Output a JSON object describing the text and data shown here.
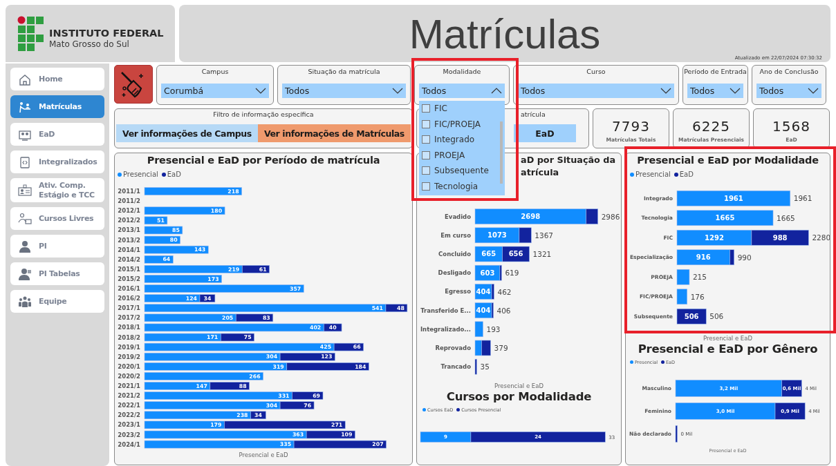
{
  "logo": {
    "name": "INSTITUTO FEDERAL",
    "subtitle": "Mato Grosso do Sul"
  },
  "header": {
    "title": "Matrículas",
    "updated": "Atualizado em 22/07/2024 07:30:32"
  },
  "sidebar": {
    "items": [
      {
        "label": "Home",
        "selected": false
      },
      {
        "label": "Matrículas",
        "selected": true
      },
      {
        "label": "EaD",
        "selected": false
      },
      {
        "label": "Integralizados",
        "selected": false
      },
      {
        "label": "Ativ. Comp.\nEstágio e TCC",
        "selected": false
      },
      {
        "label": "Cursos Livres",
        "selected": false
      },
      {
        "label": "PI",
        "selected": false
      },
      {
        "label": "PI Tabelas",
        "selected": false
      },
      {
        "label": "Equipe",
        "selected": false
      }
    ]
  },
  "filters": [
    {
      "label": "Campus",
      "value": "Corumbá",
      "expanded": false,
      "highlighted": false
    },
    {
      "label": "Situação da matrícula",
      "value": "Todos",
      "expanded": false,
      "highlighted": false
    },
    {
      "label": "Modalidade",
      "value": "Todos",
      "expanded": true,
      "highlighted": true,
      "options": [
        {
          "label": "FIC",
          "checked": false
        },
        {
          "label": "FIC/PROEJA",
          "checked": false
        },
        {
          "label": "Integrado",
          "checked": false
        },
        {
          "label": "PROEJA",
          "checked": false
        },
        {
          "label": "Subsequente",
          "checked": false
        },
        {
          "label": "Tecnologia",
          "checked": false
        }
      ]
    },
    {
      "label": "Curso",
      "value": "Todos",
      "expanded": false,
      "highlighted": false
    },
    {
      "label": "Período de Entrada",
      "value": "Todos",
      "expanded": false,
      "highlighted": false
    },
    {
      "label": "Ano de Conclusão",
      "value": "Todos",
      "expanded": false,
      "highlighted": false
    }
  ],
  "info_filter": {
    "label": "Filtro de informação específica",
    "buttons": [
      {
        "label": "Ver informações de Campus",
        "selected": false
      },
      {
        "label": "Ver informações de Matrículas",
        "selected": true
      }
    ]
  },
  "type_filter": {
    "label": "atrícula",
    "button": "EaD"
  },
  "kpis": [
    {
      "value": "7793",
      "label": "Matrículas Totais"
    },
    {
      "value": "6225",
      "label": "Matrículas Presenciais"
    },
    {
      "value": "1568",
      "label": "EaD"
    }
  ],
  "charts": [
    {
      "kind": "period",
      "highlighted": false,
      "chart_data": {
        "type": "bar",
        "orientation": "horizontal",
        "stacked": true,
        "data_labels": "value_labels",
        "title": "Presencial e EaD por Período de matrícula",
        "xlabel": "Presencial e EaD",
        "categories": [
          "2011/1",
          "2011/2",
          "2012/1",
          "2012/2",
          "2013/1",
          "2013/2",
          "2014/1",
          "2014/2",
          "2015/1",
          "2015/2",
          "2016/1",
          "2016/2",
          "2017/1",
          "2017/2",
          "2018/1",
          "2018/2",
          "2019/1",
          "2019/2",
          "2020/1",
          "2020/2",
          "2021/1",
          "2021/2",
          "2022/1",
          "2022/2",
          "2023/1",
          "2023/2",
          "2024/1"
        ],
        "series": [
          {
            "name": "Presencial",
            "color": "#118dff",
            "values": [
              218,
              null,
              180,
              51,
              85,
              80,
              143,
              64,
              219,
              173,
              357,
              124,
              541,
              205,
              402,
              171,
              425,
              304,
              319,
              266,
              147,
              331,
              304,
              238,
              179,
              363,
              335
            ],
            "value_labels": [
              "218",
              null,
              "180",
              "51",
              "85",
              "80",
              "143",
              "64",
              "219",
              "173",
              "357",
              "124",
              "541",
              "205",
              "402",
              "171",
              "425",
              "304",
              "319",
              "266",
              "147",
              "331",
              "304",
              "238",
              "179",
              "363",
              "335"
            ]
          },
          {
            "name": "EaD",
            "color": "#12239e",
            "values": [
              null,
              null,
              null,
              null,
              null,
              null,
              null,
              null,
              61,
              null,
              null,
              34,
              48,
              83,
              40,
              75,
              66,
              123,
              184,
              null,
              88,
              69,
              76,
              34,
              271,
              109,
              207
            ],
            "value_labels": [
              null,
              null,
              null,
              null,
              null,
              null,
              null,
              null,
              "61",
              null,
              null,
              "34",
              "48",
              "83",
              "40",
              "75",
              "66",
              "123",
              "184",
              null,
              "88",
              "69",
              "76",
              "34",
              "271",
              "109",
              "207"
            ]
          }
        ]
      }
    },
    {
      "kind": "situacao",
      "highlighted": false,
      "title_lines": [
        "aD por Situação da",
        "atrícula"
      ],
      "chart_data": {
        "type": "bar",
        "orientation": "horizontal",
        "stacked": true,
        "data_labels": "value_labels",
        "xlabel": "Presencial e EaD",
        "categories": [
          "Evadido",
          "Em curso",
          "Concluido",
          "Desligado",
          "Egresso",
          "Transferido E...",
          "Integralizado...",
          "Reprovado",
          "Trancado"
        ],
        "series": [
          {
            "color": "#118dff",
            "values": [
              2698,
              1073,
              665,
              603,
              404,
              404,
              193,
              160,
              null
            ],
            "value_labels": [
              "2698",
              "1073",
              "665",
              "603",
              "404",
              "404",
              null,
              null,
              null
            ]
          },
          {
            "color": "#12239e",
            "values": [
              288,
              294,
              656,
              16,
              58,
              2,
              null,
              219,
              35
            ],
            "value_labels": [
              null,
              null,
              "656",
              null,
              null,
              null,
              null,
              null,
              null
            ]
          }
        ],
        "annotations": [
          {
            "text": "2986"
          },
          {
            "text": "1367"
          },
          {
            "text": "1321"
          },
          {
            "text": "619"
          },
          {
            "text": "462"
          },
          {
            "text": "406"
          },
          {
            "text": "193"
          },
          {
            "text": "379"
          },
          {
            "text": "35"
          }
        ]
      }
    },
    {
      "kind": "cursos",
      "highlighted": false,
      "chart_data": {
        "type": "bar",
        "orientation": "horizontal",
        "stacked": true,
        "data_labels": "value_labels",
        "title": "Cursos por Modalidade",
        "series": [
          {
            "name": "Cursos EaD",
            "color": "#118dff",
            "values": [
              9
            ],
            "value_labels": [
              "9"
            ]
          },
          {
            "name": "Cursos Presencial",
            "color": "#12239e",
            "values": [
              24
            ],
            "value_labels": [
              "24"
            ]
          }
        ],
        "annotations": [
          {
            "text": "33"
          }
        ]
      }
    },
    {
      "kind": "modalidade",
      "highlighted": true,
      "chart_data": {
        "type": "bar",
        "orientation": "horizontal",
        "stacked": true,
        "data_labels": "value_labels",
        "title": "Presencial e EaD por Modalidade",
        "xlabel": "Presencial e EaD",
        "categories": [
          "Integrado",
          "Tecnologia",
          "FIC",
          "Especialização",
          "PROEJA",
          "FIC/PROEJA",
          "Subsequente"
        ],
        "series": [
          {
            "name": "Presencial",
            "color": "#118dff",
            "values": [
              1961,
              1665,
              1292,
              916,
              215,
              176,
              null
            ],
            "value_labels": [
              "1961",
              "1665",
              "1292",
              "916",
              null,
              null,
              null
            ]
          },
          {
            "name": "EaD",
            "color": "#12239e",
            "values": [
              null,
              null,
              988,
              74,
              null,
              null,
              506
            ],
            "value_labels": [
              null,
              null,
              "988",
              null,
              null,
              null,
              "506"
            ]
          }
        ],
        "annotations": [
          {
            "text": "1961"
          },
          {
            "text": "1665"
          },
          {
            "text": "2280"
          },
          {
            "text": "990"
          },
          {
            "text": "215"
          },
          {
            "text": "176"
          },
          {
            "text": "506"
          }
        ]
      }
    },
    {
      "kind": "genero",
      "highlighted": false,
      "chart_data": {
        "type": "bar",
        "orientation": "horizontal",
        "stacked": true,
        "data_labels": "value_labels",
        "title": "Presencial e EaD por Gênero",
        "xlabel": "Presencial e EaD",
        "categories": [
          "Masculino",
          "Feminino",
          "Não declarado"
        ],
        "series": [
          {
            "name": "Presencial",
            "color": "#118dff",
            "values": [
              3.2,
              3.0,
              null
            ],
            "value_labels": [
              "3,2 Mil",
              "3,0 Mil",
              null
            ]
          },
          {
            "name": "EaD",
            "color": "#12239e",
            "values": [
              0.6,
              0.9,
              0.01
            ],
            "value_labels": [
              "0,6 Mil",
              "0,9 Mil",
              null
            ]
          }
        ],
        "annotations": [
          {
            "text": "4 Mil"
          },
          {
            "text": "4 Mil"
          },
          {
            "text": "0 Mil"
          }
        ]
      }
    }
  ]
}
